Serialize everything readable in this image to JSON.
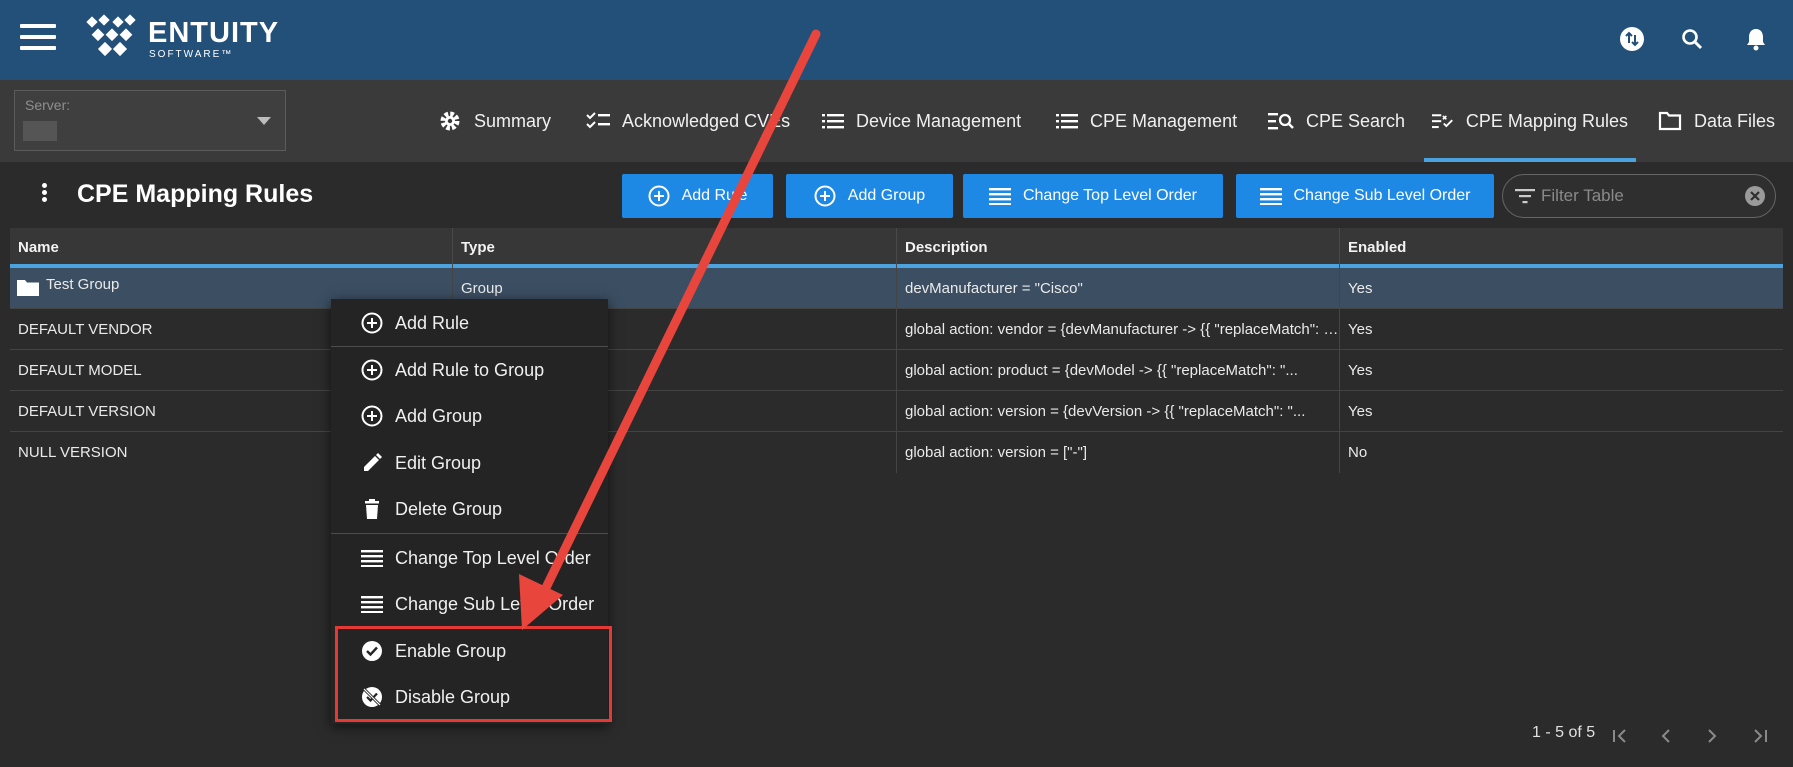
{
  "brand": {
    "name": "ENTUITY",
    "sub": "SOFTWARE™"
  },
  "server": {
    "label": "Server:"
  },
  "tabs": [
    {
      "label": "Summary",
      "icon": "gear-icon"
    },
    {
      "label": "Acknowledged CVEs",
      "icon": "checklist-icon"
    },
    {
      "label": "Device Management",
      "icon": "list-icon"
    },
    {
      "label": "CPE Management",
      "icon": "list-icon"
    },
    {
      "label": "CPE Search",
      "icon": "list-search-icon"
    },
    {
      "label": "CPE Mapping Rules",
      "icon": "list-check-icon",
      "active": true
    },
    {
      "label": "Data Files",
      "icon": "folder-icon"
    }
  ],
  "page": {
    "title": "CPE Mapping Rules"
  },
  "toolbar": {
    "add_rule": "Add Rule",
    "add_group": "Add Group",
    "change_top": "Change Top Level Order",
    "change_sub": "Change Sub Level Order",
    "filter_placeholder": "Filter Table"
  },
  "table": {
    "columns": [
      "Name",
      "Type",
      "Description",
      "Enabled"
    ],
    "rows": [
      {
        "name": "Test Group",
        "type": "Group",
        "description": "devManufacturer = \"Cisco\"",
        "enabled": "Yes"
      },
      {
        "name": "DEFAULT VENDOR",
        "type": "",
        "description": "global action: vendor = {devManufacturer -> {{ \"replaceMatch\": \"...",
        "enabled": "Yes"
      },
      {
        "name": "DEFAULT MODEL",
        "type": "",
        "description": "global action: product = {devModel -> {{ \"replaceMatch\": \"...",
        "enabled": "Yes"
      },
      {
        "name": "DEFAULT VERSION",
        "type": "",
        "description": "global action: version = {devVersion -> {{ \"replaceMatch\": \"...",
        "enabled": "Yes"
      },
      {
        "name": "NULL VERSION",
        "type": "",
        "description": "global action: version = [\"-\"]",
        "enabled": "No"
      }
    ]
  },
  "context_menu": [
    "Add Rule",
    "Add Rule to Group",
    "Add Group",
    "Edit Group",
    "Delete Group",
    "Change Top Level Order",
    "Change Sub Level Order",
    "Enable Group",
    "Disable Group"
  ],
  "pager": {
    "range": "1 - 5 of 5"
  },
  "colors": {
    "header": "#235079",
    "accent": "#1e88e5",
    "highlight": "#e53935"
  }
}
